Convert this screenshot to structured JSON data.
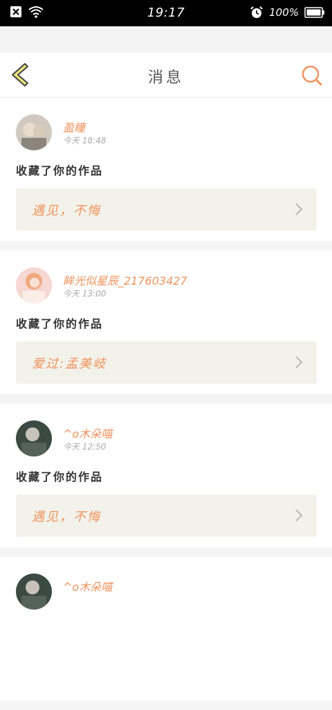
{
  "status_bar": {
    "time": "19:17",
    "battery_percent": "100%",
    "icons": [
      "close-box-icon",
      "wifi-icon",
      "alarm-icon",
      "battery-icon"
    ]
  },
  "nav": {
    "title": "消息",
    "back_icon": "chevron-left-icon",
    "search_icon": "search-icon"
  },
  "colors": {
    "accent": "#f0935d",
    "back_arrow_fill": "#e9e07a",
    "card_tile": "#f3f2ea"
  },
  "messages": [
    {
      "username": "盈瞳",
      "time": "今天 18:48",
      "action": "收藏了你的作品",
      "work_title": "遇见，不悔"
    },
    {
      "username": "眸光似星辰_217603427",
      "time": "今天 13:00",
      "action": "收藏了你的作品",
      "work_title": "爱过:孟美岐"
    },
    {
      "username": "^o木朵喵",
      "time": "今天 12:50",
      "action": "收藏了你的作品",
      "work_title": "遇见，不悔"
    },
    {
      "username": "^o木朵喵",
      "time": "",
      "action": "",
      "work_title": ""
    }
  ]
}
